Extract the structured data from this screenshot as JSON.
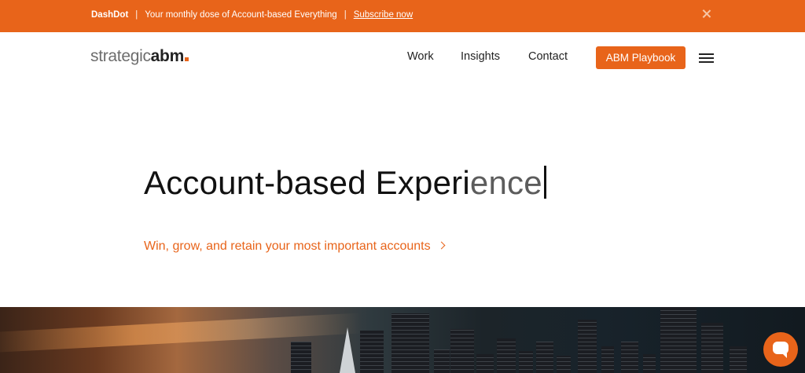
{
  "announcement": {
    "brand": "DashDot",
    "separator": "|",
    "message": "Your monthly dose of Account-based Everything",
    "cta": "Subscribe now",
    "close_icon": "close-icon"
  },
  "header": {
    "logo_light": "strategic",
    "logo_bold": "abm",
    "nav": [
      "Work",
      "Insights",
      "Contact"
    ],
    "cta": "ABM Playbook",
    "menu_icon": "hamburger-menu-icon"
  },
  "hero": {
    "title_solid": "Account-based Experi",
    "title_fade": "ence",
    "link": "Win, grow, and retain your most important accounts"
  },
  "chat": {
    "icon": "chat-bubble-icon"
  },
  "colors": {
    "accent": "#e8641a",
    "text": "#111111"
  }
}
